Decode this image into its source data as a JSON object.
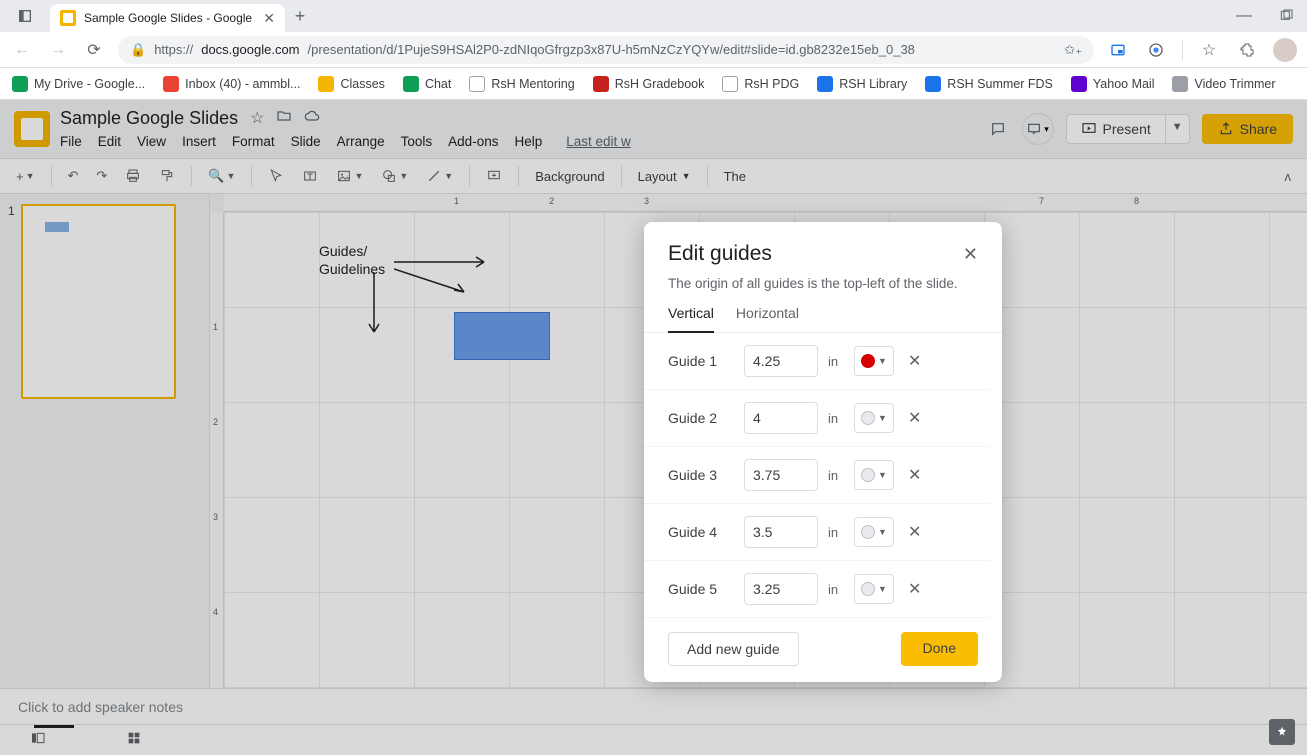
{
  "browser": {
    "tab_title": "Sample Google Slides - Google S",
    "url_prefix": "https://",
    "url_host": "docs.google.com",
    "url_path": "/presentation/d/1PujeS9HSAl2P0-zdNIqoGfrgzp3x87U-h5mNzCzYQYw/edit#slide=id.gb8232e15eb_0_38"
  },
  "bookmarks": [
    {
      "label": "My Drive - Google...",
      "color": "#0f9d58"
    },
    {
      "label": "Inbox (40) - ammbl...",
      "color": "#ea4335"
    },
    {
      "label": "Classes",
      "color": "#f4b400"
    },
    {
      "label": "Chat",
      "color": "#0f9d58"
    },
    {
      "label": "RsH Mentoring",
      "color": "#ffffff"
    },
    {
      "label": "RsH Gradebook",
      "color": "#c5221f"
    },
    {
      "label": "RsH PDG",
      "color": "#ffffff"
    },
    {
      "label": "RSH Library",
      "color": "#1a73e8"
    },
    {
      "label": "RSH Summer FDS",
      "color": "#1a73e8"
    },
    {
      "label": "Yahoo Mail",
      "color": "#5f01d1"
    },
    {
      "label": "Video Trimmer",
      "color": "#9aa0a6"
    }
  ],
  "doc": {
    "title": "Sample Google Slides",
    "last_edit": "Last edit w"
  },
  "menus": [
    "File",
    "Edit",
    "View",
    "Insert",
    "Format",
    "Slide",
    "Arrange",
    "Tools",
    "Add-ons",
    "Help"
  ],
  "header_buttons": {
    "present": "Present",
    "share": "Share"
  },
  "toolbar": {
    "background": "Background",
    "layout": "Layout",
    "theme": "The"
  },
  "ruler_h": [
    "1",
    "2",
    "3",
    "7",
    "8"
  ],
  "ruler_v": [
    "1",
    "2",
    "3",
    "4"
  ],
  "annotation": {
    "line1": "Guides/",
    "line2": "Guidelines"
  },
  "notes_placeholder": "Click to add speaker notes",
  "dialog": {
    "title": "Edit guides",
    "desc": "The origin of all guides is the top-left of the slide.",
    "tab_vertical": "Vertical",
    "tab_horizontal": "Horizontal",
    "unit": "in",
    "guides": [
      {
        "label": "Guide 1",
        "value": "4.25",
        "color": "#d50000"
      },
      {
        "label": "Guide 2",
        "value": "4",
        "color": "#e8eaed"
      },
      {
        "label": "Guide 3",
        "value": "3.75",
        "color": "#e8eaed"
      },
      {
        "label": "Guide 4",
        "value": "3.5",
        "color": "#e8eaed"
      },
      {
        "label": "Guide 5",
        "value": "3.25",
        "color": "#e8eaed"
      }
    ],
    "add_new": "Add new guide",
    "done": "Done"
  },
  "thumb_number": "1"
}
